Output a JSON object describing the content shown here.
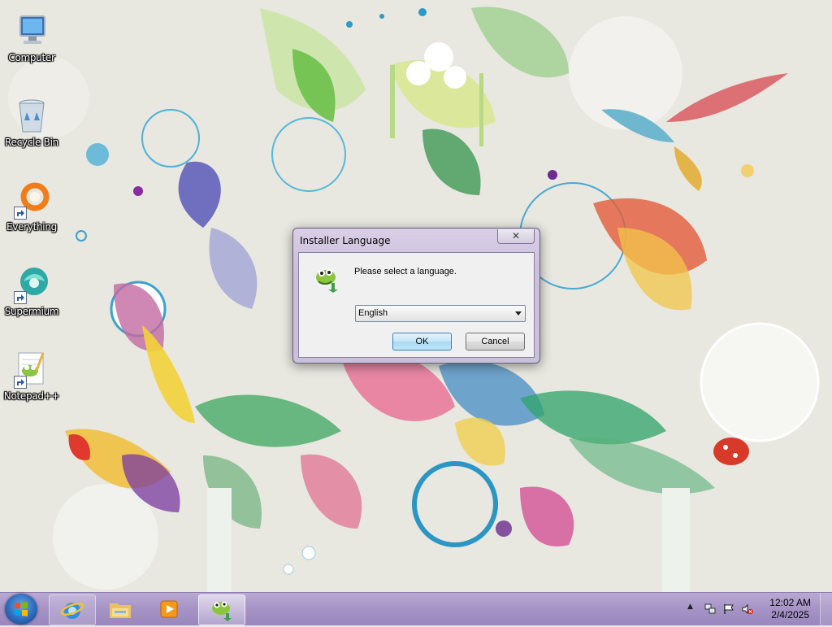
{
  "desktop": {
    "icons": [
      {
        "label": "Computer",
        "icon": "computer-icon"
      },
      {
        "label": "Recycle Bin",
        "icon": "recycle-bin-icon"
      },
      {
        "label": "Everything",
        "icon": "everything-search-icon"
      },
      {
        "label": "Supermium",
        "icon": "supermium-browser-icon"
      },
      {
        "label": "Notepad++",
        "icon": "notepad-plus-plus-icon"
      }
    ]
  },
  "dialog": {
    "title": "Installer Language",
    "close_glyph": "✕",
    "prompt": "Please select a language.",
    "language_selected": "English",
    "ok_label": "OK",
    "cancel_label": "Cancel"
  },
  "taskbar": {
    "items": [
      {
        "icon": "internet-explorer-icon",
        "state": "pinned"
      },
      {
        "icon": "file-explorer-icon",
        "state": "pinned"
      },
      {
        "icon": "media-player-icon",
        "state": "pinned"
      },
      {
        "icon": "notepad-plus-plus-installer-icon",
        "state": "active"
      }
    ],
    "tray": {
      "show_hidden_glyph": "▲",
      "icons": [
        "network-icon",
        "action-center-flag-icon",
        "volume-muted-icon"
      ]
    },
    "clock": {
      "time": "12:02 AM",
      "date": "2/4/2025"
    }
  },
  "colors": {
    "taskbar": "#a895c7",
    "dialog_frame": "#cbc0dd",
    "ok_button": "#c4e5f6"
  }
}
